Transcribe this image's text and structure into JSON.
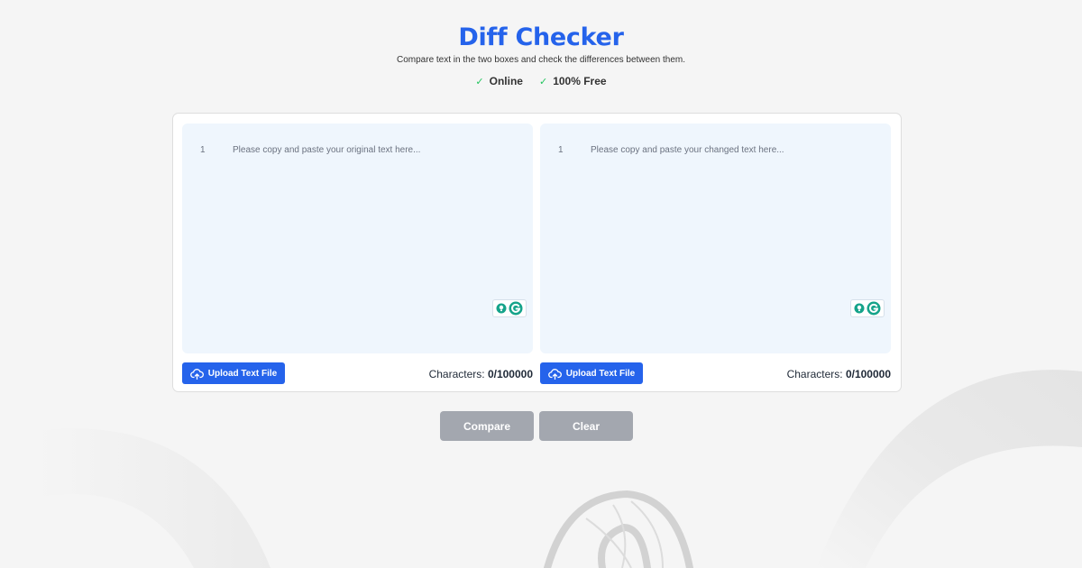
{
  "header": {
    "title": "Diff Checker",
    "subtitle": "Compare text in the two boxes and check the differences between them.",
    "features": [
      {
        "icon": "check-icon",
        "label": "Online"
      },
      {
        "icon": "check-icon",
        "label": "100% Free"
      }
    ]
  },
  "original": {
    "line_number": "1",
    "placeholder": "Please copy and paste your original text here...",
    "upload_label": "Upload Text File",
    "char_label": "Characters:",
    "char_value": "0/100000"
  },
  "changed": {
    "line_number": "1",
    "placeholder": "Please copy and paste your changed text here...",
    "upload_label": "Upload Text File",
    "char_label": "Characters:",
    "char_value": "0/100000"
  },
  "actions": {
    "compare_label": "Compare",
    "clear_label": "Clear"
  },
  "colors": {
    "accent": "#2563eb",
    "check": "#22c55e",
    "editor_bg": "#eff6fd",
    "disabled_button": "#a3a7af",
    "grammarly": "#15a38a"
  }
}
